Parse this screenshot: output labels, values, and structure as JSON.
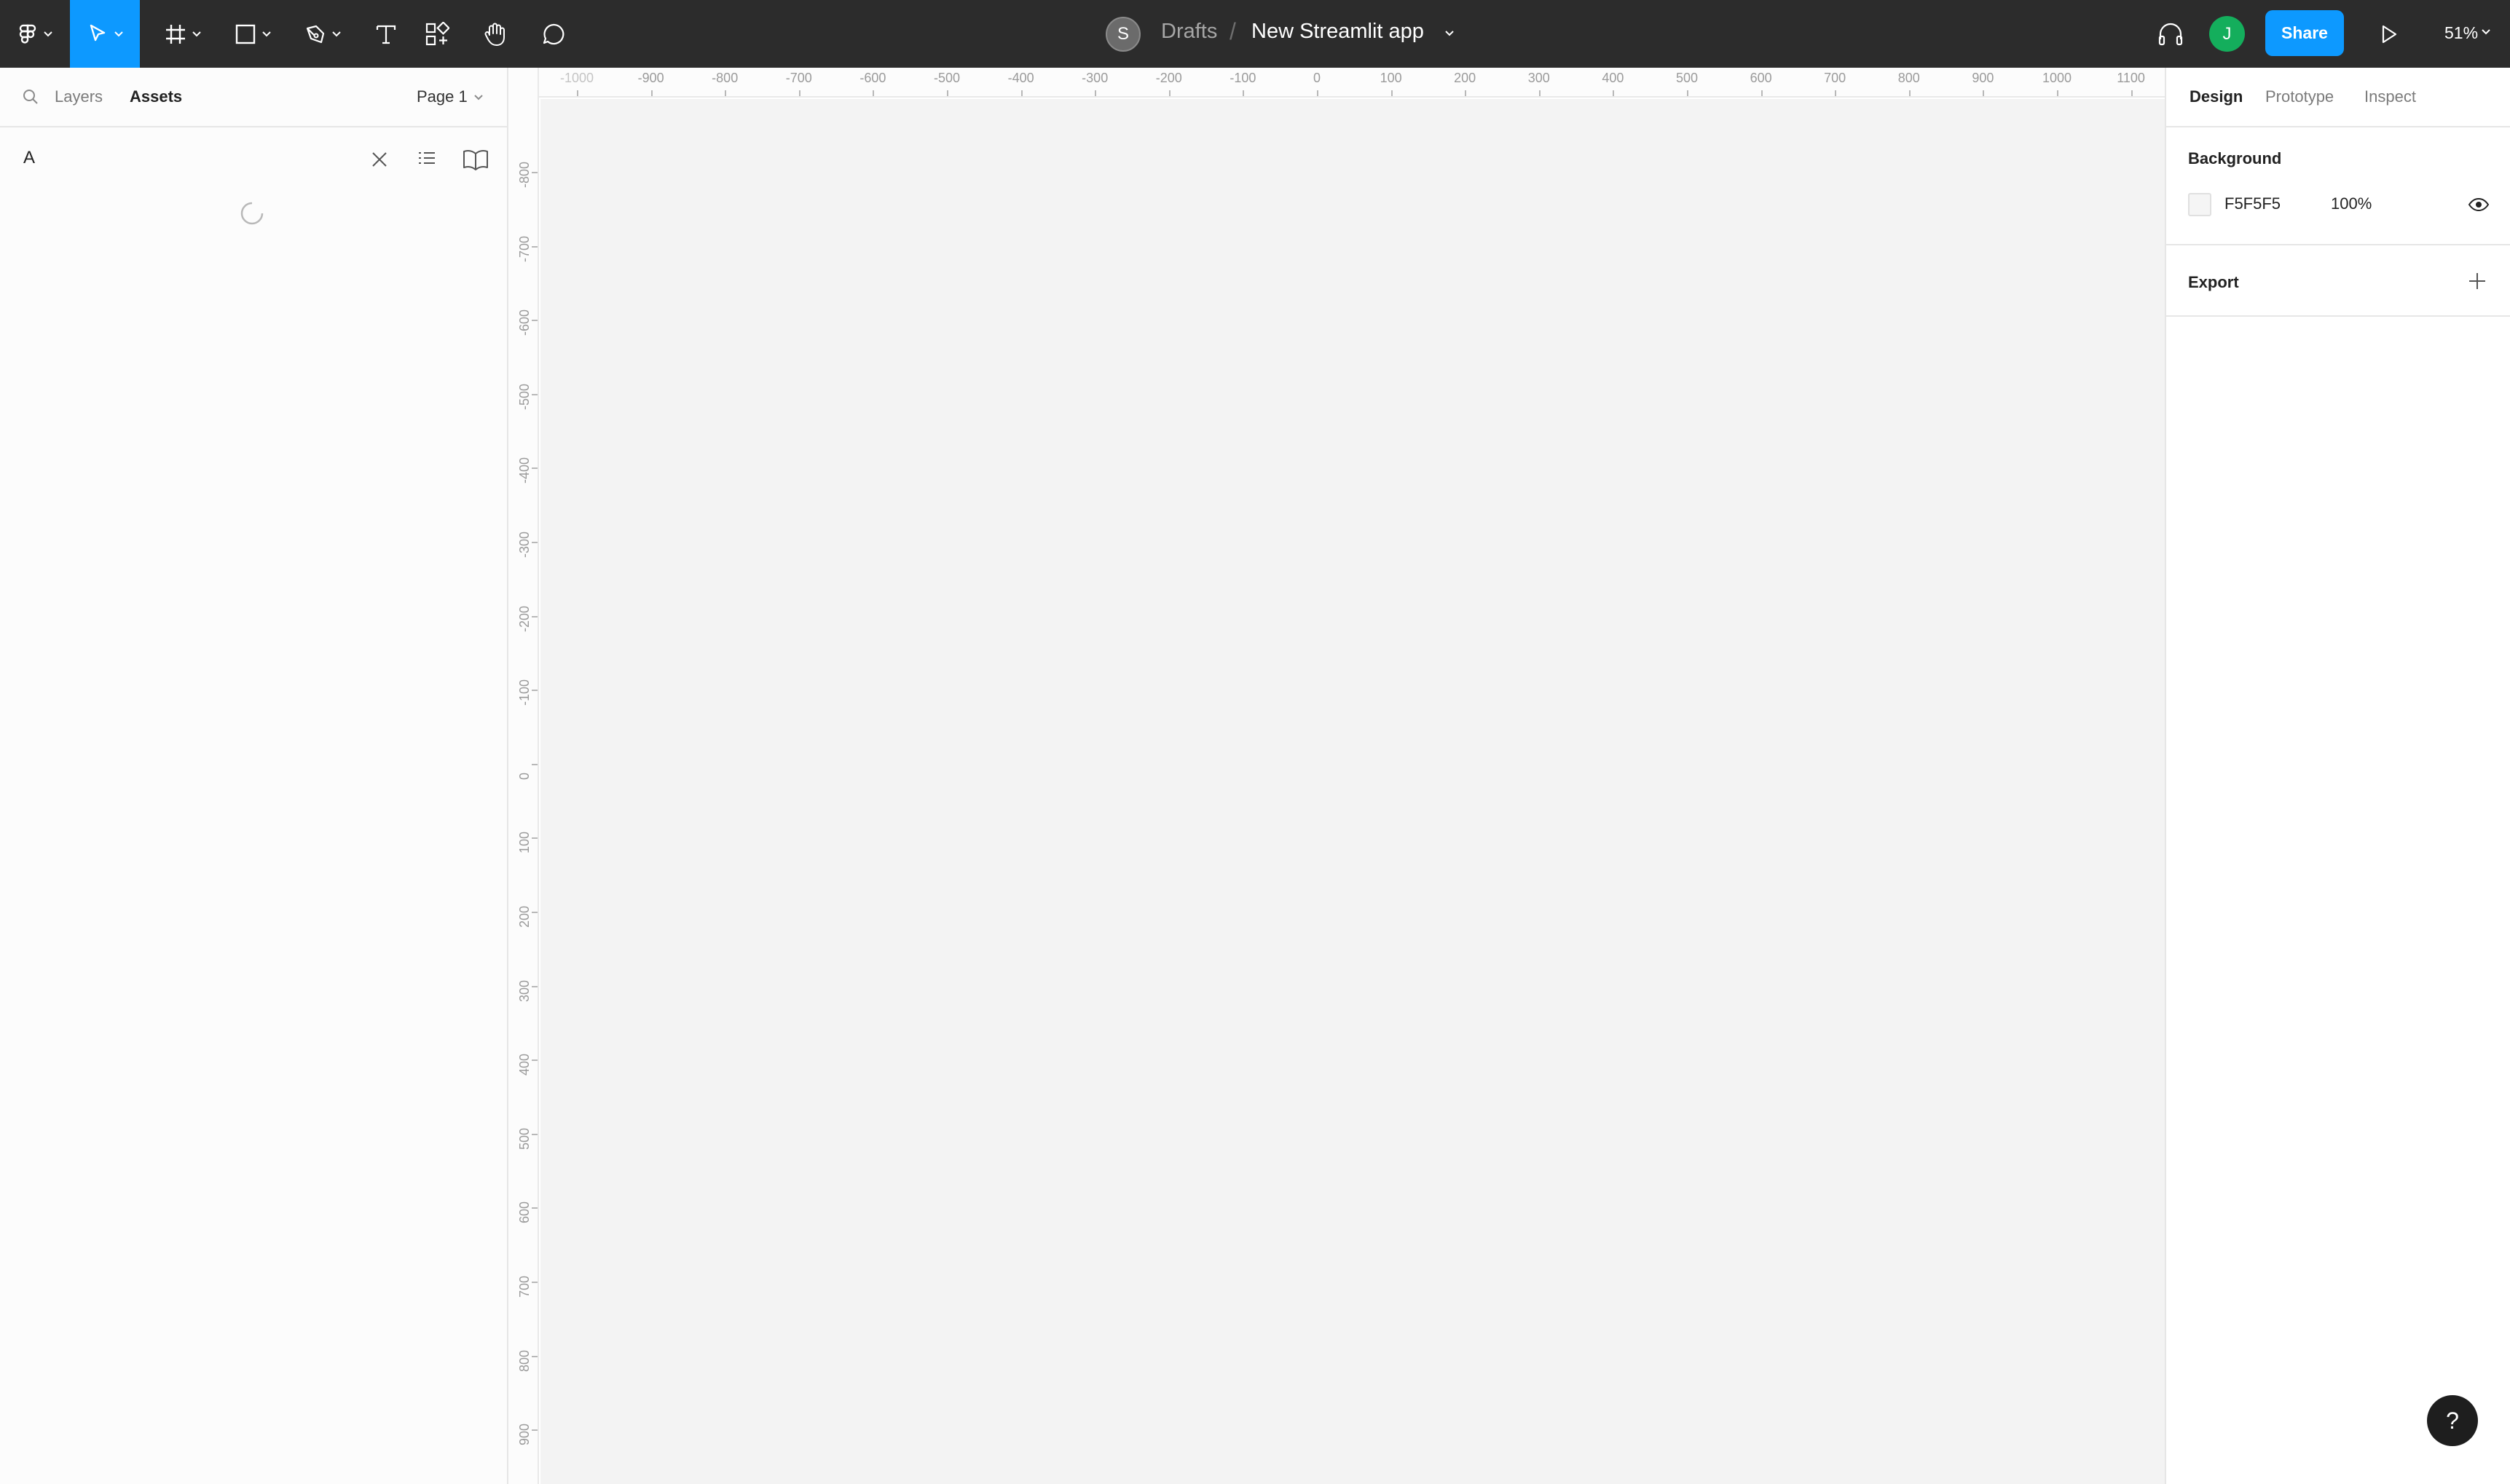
{
  "toolbar": {
    "file_owner_initial": "S",
    "breadcrumb_drafts": "Drafts",
    "breadcrumb_separator": "/",
    "file_name": "New Streamlit app",
    "user_initial": "J",
    "share_label": "Share",
    "zoom_label": "51%",
    "colors": {
      "bar": "#2c2c2c",
      "active_tool": "#0d99ff",
      "user_avatar": "#14ae5c"
    },
    "tools": [
      "figma-menu-icon",
      "move-tool-icon",
      "frame-tool-icon",
      "shape-tool-icon",
      "pen-tool-icon",
      "text-tool-icon",
      "components-icon",
      "hand-tool-icon",
      "comment-tool-icon"
    ]
  },
  "left_panel": {
    "tab_layers": "Layers",
    "tab_assets": "Assets",
    "page_label": "Page 1",
    "search_value": "A",
    "icons": [
      "search-icon",
      "clear-search-icon",
      "list-view-icon",
      "library-icon",
      "loading-spinner-icon"
    ]
  },
  "rulers": {
    "top_labels": [
      "-1000",
      "-900",
      "-800",
      "-700",
      "-600",
      "-500",
      "-400",
      "-300",
      "-200",
      "-100",
      "0",
      "100",
      "200",
      "300",
      "400",
      "500",
      "600",
      "700",
      "800",
      "900",
      "1000",
      "1100"
    ],
    "left_labels": [
      "-800",
      "-700",
      "-600",
      "-500",
      "-400",
      "-300",
      "-200",
      "-100",
      "0",
      "100",
      "200",
      "300",
      "400",
      "500",
      "600",
      "700",
      "800",
      "900"
    ]
  },
  "canvas": {
    "background": "#f3f3f3"
  },
  "right_panel": {
    "tab_design": "Design",
    "tab_prototype": "Prototype",
    "tab_inspect": "Inspect",
    "background_title": "Background",
    "background_hex": "F5F5F5",
    "background_opacity": "100%",
    "export_title": "Export"
  },
  "help_label": "?"
}
